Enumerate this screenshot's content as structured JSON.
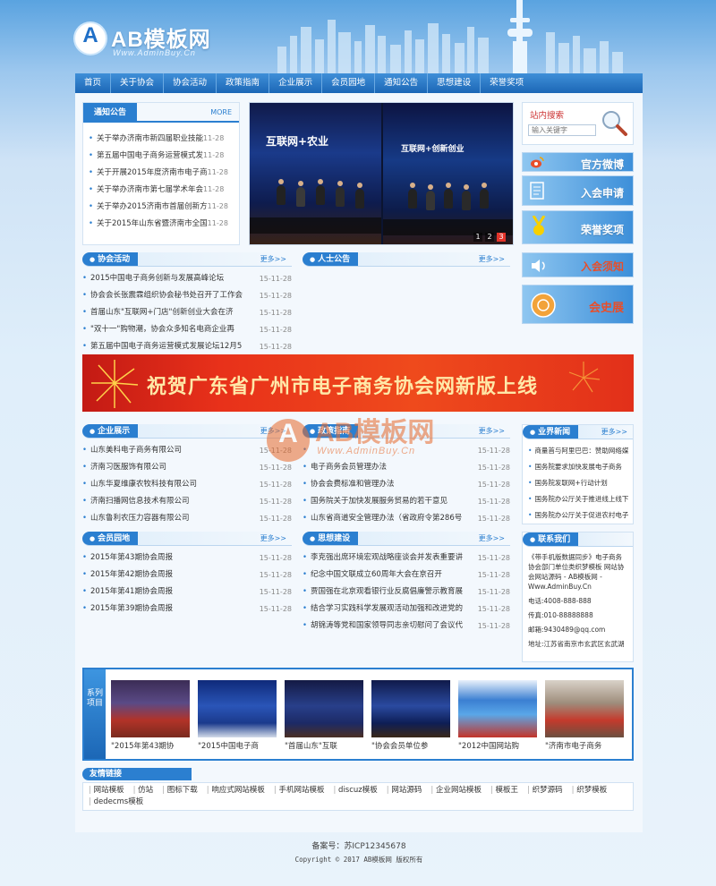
{
  "brand": {
    "logo_letter": "A",
    "name": "AB模板网",
    "url": "Www.AdminBuy.Cn"
  },
  "nav": [
    "首页",
    "关于协会",
    "协会活动",
    "政策指南",
    "企业展示",
    "会员园地",
    "通知公告",
    "思想建设",
    "荣誉奖项"
  ],
  "notice": {
    "title": "通知公告",
    "more": "MORE",
    "items": [
      {
        "text": "关于举办济南市新四届职业技能",
        "date": "11-28"
      },
      {
        "text": "第五届中国电子商务运营模式发",
        "date": "11-28"
      },
      {
        "text": "关于开展2015年度济南市电子商",
        "date": "11-28"
      },
      {
        "text": "关于举办济南市第七届学术年会",
        "date": "11-28"
      },
      {
        "text": "关于举办2015济南市首届创新方",
        "date": "11-28"
      },
      {
        "text": "关于2015年山东省暨济南市全国",
        "date": "11-28"
      }
    ]
  },
  "slide": {
    "sign_left": "互联网+农业",
    "sign_right": "互联网+创新创业",
    "pages": [
      "1",
      "2",
      "3"
    ]
  },
  "search": {
    "title": "站内搜索",
    "placeholder": "输入关键字"
  },
  "side_banners": [
    {
      "label": "官方微博",
      "icon": "weibo-icon"
    },
    {
      "label": "入会申请",
      "icon": "form-icon"
    },
    {
      "label": "荣誉奖项",
      "icon": "medal-icon"
    },
    {
      "label": "入会须知",
      "icon": "speaker-icon"
    },
    {
      "label": "会史展",
      "icon": "emblem-icon"
    }
  ],
  "activities": {
    "title": "协会活动",
    "more": "更多>>",
    "items": [
      {
        "text": "2015中国电子商务创新与发展高峰论坛",
        "date": "15-11-28"
      },
      {
        "text": "协会会长张震霖组织协会秘书处召开了工作会",
        "date": "15-11-28"
      },
      {
        "text": "首届山东\"互联网+门店\"创新创业大会在济",
        "date": "15-11-28"
      },
      {
        "text": "\"双十一\"购物潮，协会众多知名电商企业再",
        "date": "15-11-28"
      },
      {
        "text": "第五届中国电子商务运营模式发展论坛12月5",
        "date": "15-11-28"
      }
    ]
  },
  "people": {
    "title": "人士公告",
    "more": "更多>>"
  },
  "big_banner": {
    "text": "祝贺广东省广州市电子商务协会网新版上线"
  },
  "companies": {
    "title": "企业展示",
    "more": "更多>>",
    "items": [
      {
        "text": "山东美科电子商务有限公司",
        "date": "15-11-28"
      },
      {
        "text": "济南习医服饰有限公司",
        "date": "15-11-28"
      },
      {
        "text": "山东华夏维康农牧科技有限公司",
        "date": "15-11-28"
      },
      {
        "text": "济南扫播网信息技术有限公司",
        "date": "15-11-28"
      },
      {
        "text": "山东鲁利农压力容器有限公司",
        "date": "15-11-28"
      }
    ]
  },
  "policy": {
    "title": "政策指南",
    "more": "更多>>",
    "items": [
      {
        "text": "",
        "date": "15-11-28"
      },
      {
        "text": "电子商务会员管理办法",
        "date": "15-11-28"
      },
      {
        "text": "协会会费标准和管理办法",
        "date": "15-11-28"
      },
      {
        "text": "国务院关于加快发展服务贸易的若干意见",
        "date": "15-11-28"
      },
      {
        "text": "山东省商道安全管理办法（省政府令第286号",
        "date": "15-11-28"
      }
    ]
  },
  "industry": {
    "title": "业界新闻",
    "more": "更多>>",
    "items": [
      "商量首与阿里巴巴：赞助网络媒",
      "国务院要求加快发展电子商务",
      "国务院发联网+行动计划",
      "国务院办公厅关于推进线上线下",
      "国务院办公厅关于促进农村电子"
    ]
  },
  "members": {
    "title": "会员园地",
    "more": "更多>>",
    "items": [
      {
        "text": "2015年第43期协会周报",
        "date": "15-11-28"
      },
      {
        "text": "2015年第42期协会周报",
        "date": "15-11-28"
      },
      {
        "text": "2015年第41期协会周报",
        "date": "15-11-28"
      },
      {
        "text": "2015年第39期协会周报",
        "date": "15-11-28"
      }
    ]
  },
  "thought": {
    "title": "思想建设",
    "more": "更多>>",
    "items": [
      {
        "text": "李克强出席环境宏观战略座谈会并发表重要讲",
        "date": "15-11-28"
      },
      {
        "text": "纪念中国文联成立60周年大会在京召开",
        "date": "15-11-28"
      },
      {
        "text": "贾国强在北京观看银行业反腐倡廉警示教育展",
        "date": "15-11-28"
      },
      {
        "text": "结合学习实践科学发展观活动加强和改进党的",
        "date": "15-11-28"
      },
      {
        "text": "胡锦涛等党和国家领导同志亲切慰问了会议代",
        "date": "15-11-28"
      }
    ]
  },
  "contact": {
    "title": "联系我们",
    "intro": "《带手机版数据同步》电子商务协会部门单位类织梦模板 网站协会网站源码 - AB模板网 - Www.AdminBuy.Cn",
    "phone": "电话:4008-888-888",
    "fax": "传真:010-88888888",
    "email": "邮箱:9430489@qq.com",
    "address": "地址:江苏省南京市玄武区玄武湖"
  },
  "carousel": {
    "side_label": "系列项目",
    "items": [
      {
        "caption": "\"2015年第43期协"
      },
      {
        "caption": "\"2015中国电子商"
      },
      {
        "caption": "\"首届山东\"互联"
      },
      {
        "caption": "\"协会会员单位参"
      },
      {
        "caption": "\"2012中国网站购"
      },
      {
        "caption": "\"济南市电子商务"
      }
    ]
  },
  "links": {
    "title": "友情链接",
    "items": [
      "网站模板",
      "仿站",
      "图标下载",
      "响应式网站模板",
      "手机网站模板",
      "discuz模板",
      "网站源码",
      "企业网站模板",
      "模板王",
      "织梦源码",
      "织梦模板",
      "dedecms模板"
    ]
  },
  "footer": {
    "icp": "备案号：苏ICP12345678",
    "copyright": "Copyright © 2017 AB模板网 版权所有"
  },
  "watermark": {
    "letter": "A",
    "name": "AB模板网",
    "url": "Www.AdminBuy.Cn"
  },
  "colors": {
    "primary": "#2b7fd0",
    "nav": "#1c67b6",
    "banner_red": "#e8311a",
    "banner_text": "#ffe8a8",
    "watermark": "#e86a2c"
  }
}
